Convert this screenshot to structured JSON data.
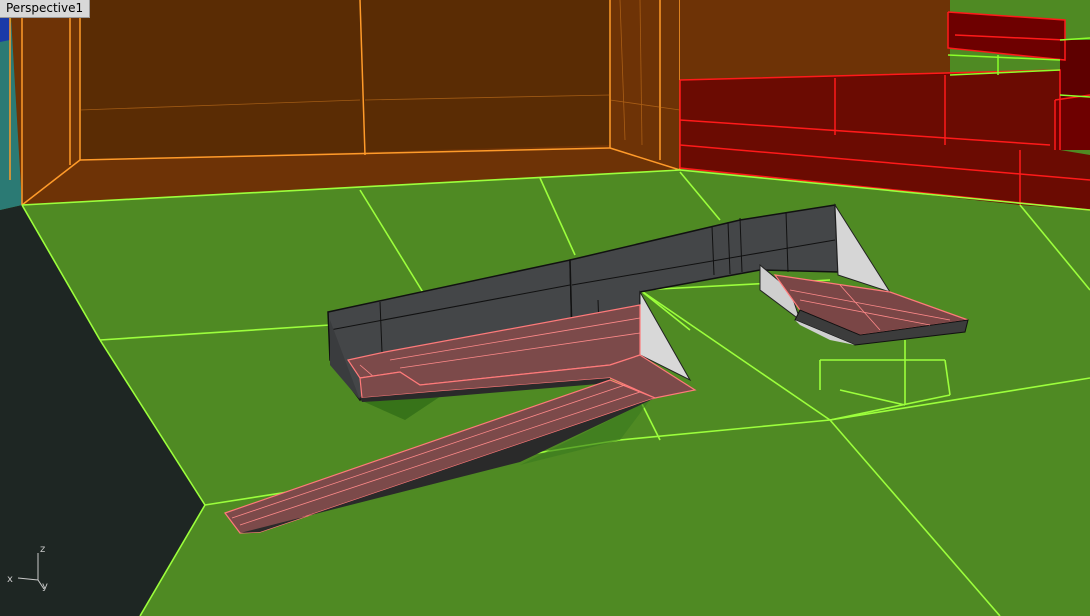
{
  "viewport": {
    "title": "Perspective1"
  },
  "axes": {
    "z": "z",
    "x": "x",
    "y": "y"
  },
  "colors": {
    "ground": "#4f8a23",
    "ground_edges": "#9cff3c",
    "orange_walls": "#7a3a05",
    "orange_edges": "#ff9b2a",
    "red_blocks": "#7a0000",
    "red_edges": "#ff1a1a",
    "dark_wall": "#4a4a4a",
    "ramp": "#7c4a4a",
    "ramp_edges": "#ff7a7a"
  }
}
